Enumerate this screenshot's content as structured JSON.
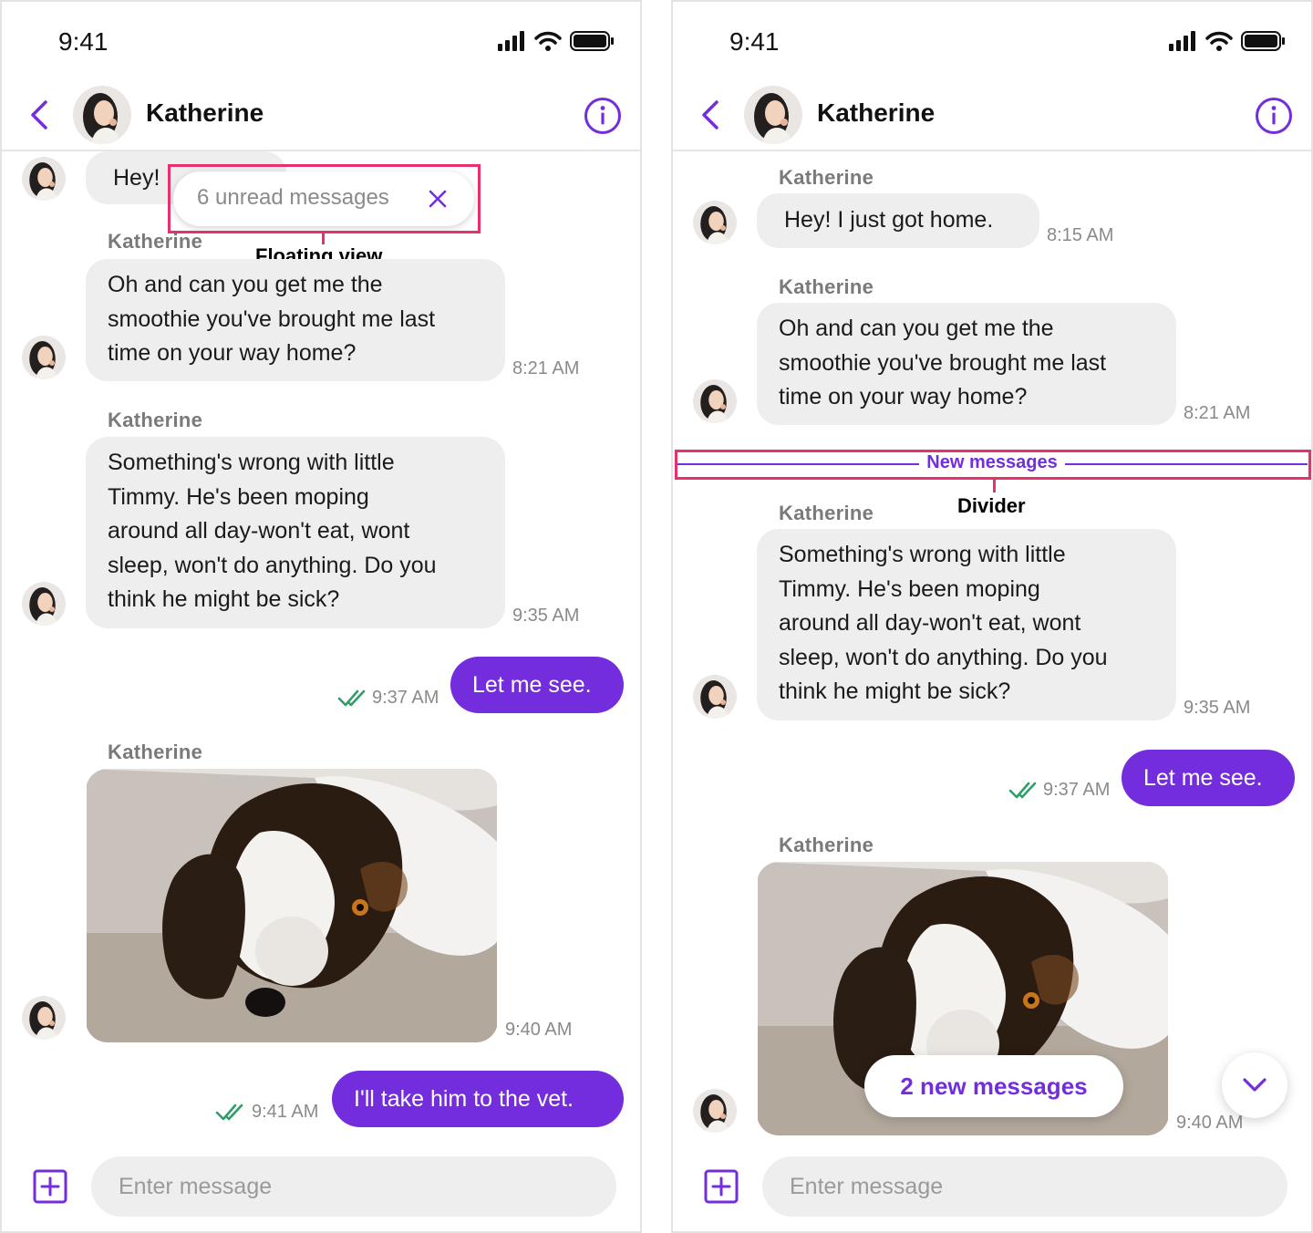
{
  "colors": {
    "accent": "#742ddd",
    "highlight": "#e8306e",
    "read_check": "#2f9e6a"
  },
  "status_bar": {
    "time": "9:41"
  },
  "header": {
    "contact_name": "Katherine"
  },
  "sender_name": "Katherine",
  "messages": {
    "greeting": {
      "text": "Hey! I just got home.",
      "clipped_text": "Hey! I",
      "time": "8:15 AM"
    },
    "smoothie": {
      "text": "Oh and can you get me the smoothie you've brought me last time on your way home?",
      "lines": [
        "Oh and can you get me the",
        "smoothie you've brought me last",
        "time on your way home?"
      ],
      "time": "8:21 AM"
    },
    "timmy": {
      "lines": [
        "Something's wrong with little",
        "Timmy. He's been moping",
        "around all day-won't eat, wont",
        "sleep, won't do anything. Do you",
        "think he might be sick?"
      ],
      "time": "9:35 AM"
    },
    "reply_see": {
      "text": "Let me see.",
      "time": "9:37 AM"
    },
    "photo": {
      "time": "9:40 AM",
      "subject": "dog-photo"
    },
    "reply_vet": {
      "text": "I'll take him to the vet.",
      "time": "9:41 AM"
    }
  },
  "floating_view": {
    "text": "6 unread messages",
    "close_icon": "close-icon",
    "annotation": "Floating view"
  },
  "divider": {
    "label": "New messages",
    "annotation": "Divider"
  },
  "new_messages_pill": {
    "text": "2 new messages"
  },
  "scroll_button": {
    "icon": "chevron-down-icon"
  },
  "composer": {
    "placeholder": "Enter message",
    "add_icon": "plus-square-icon"
  }
}
